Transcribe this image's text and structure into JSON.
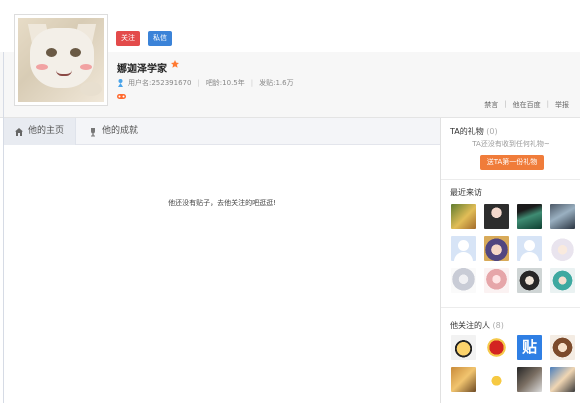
{
  "header": {
    "follow_label": "关注",
    "message_label": "私信",
    "username": "娜迦泽学家",
    "user_id_label": "用户名:252391670",
    "bar_age_label": "吧龄:10.5年",
    "posts_label": "发贴:1.6万",
    "links": [
      "禁言",
      "他在百度",
      "举报"
    ],
    "colors": {
      "follow": "#e34b4b",
      "message": "#3b83d8",
      "gift_button": "#f07c3a"
    },
    "icons": {
      "gender": "gender-icon",
      "badge": "flame-badge-icon",
      "game": "game-controller-icon"
    }
  },
  "tabs": [
    {
      "label": "他的主页",
      "icon": "home-icon",
      "active": true
    },
    {
      "label": "他的成就",
      "icon": "trophy-icon",
      "active": false
    }
  ],
  "main": {
    "empty_message": "他还没有贴子，去他关注的吧逛逛!"
  },
  "sidebar": {
    "gifts": {
      "title": "TA的礼物",
      "count": "(0)",
      "note": "TA还没有收到任何礼物~",
      "button_label": "送TA第一份礼物"
    },
    "visitors": {
      "title": "最近来访"
    },
    "following": {
      "title": "他关注的人",
      "count": "(8)",
      "tieba_glyph": "贴"
    }
  }
}
